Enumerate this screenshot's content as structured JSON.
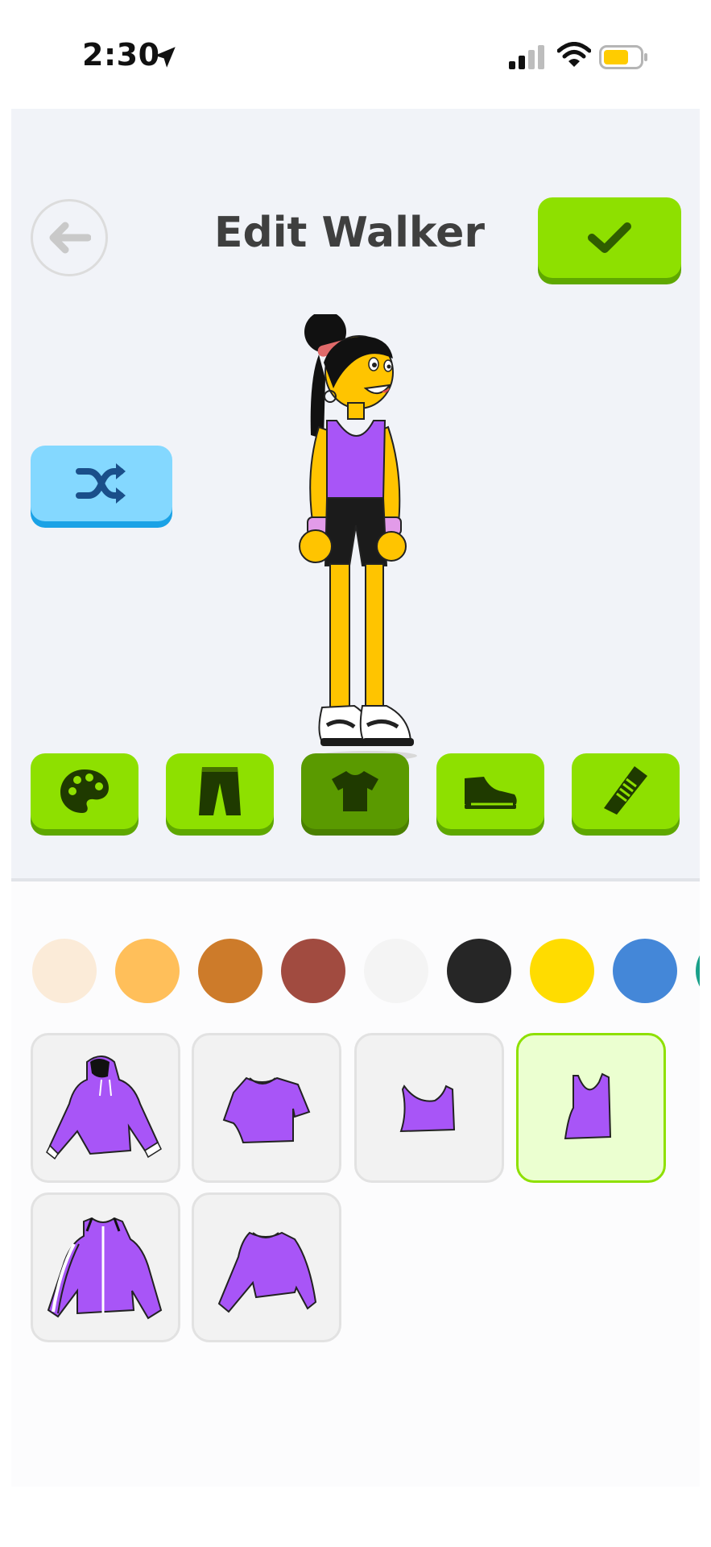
{
  "status_bar": {
    "time": "2:30",
    "icons": [
      "location-arrow-icon",
      "cellular-signal-icon",
      "wifi-icon",
      "battery-icon"
    ],
    "battery_color": "#ffcc00"
  },
  "header": {
    "title": "Edit Walker",
    "back_icon": "arrow-left-icon",
    "confirm_icon": "checkmark-icon"
  },
  "shuffle": {
    "icon": "shuffle-icon"
  },
  "categories": [
    {
      "id": "skin",
      "icon": "palette-icon",
      "selected": false
    },
    {
      "id": "bottoms",
      "icon": "pants-icon",
      "selected": false
    },
    {
      "id": "tops",
      "icon": "shirt-icon",
      "selected": true
    },
    {
      "id": "shoes",
      "icon": "shoe-icon",
      "selected": false
    },
    {
      "id": "hair",
      "icon": "comb-icon",
      "selected": false
    }
  ],
  "color_swatches": [
    "#fbebd8",
    "#ffbf5a",
    "#cd7b2a",
    "#a14b40",
    "#f4f4f4",
    "#262626",
    "#ffdc00",
    "#4487d8",
    "#1aa08a"
  ],
  "items": [
    {
      "name": "hoodie",
      "selected": false
    },
    {
      "name": "t-shirt",
      "selected": false
    },
    {
      "name": "crop-tank",
      "selected": false
    },
    {
      "name": "tank-top",
      "selected": true
    },
    {
      "name": "track-jacket",
      "selected": false
    },
    {
      "name": "long-sleeve-crop",
      "selected": false
    }
  ],
  "colors": {
    "accent_green": "#8ee000",
    "accent_green_dark": "#5a9a00",
    "shuffle_blue": "#84d8ff",
    "item_purple": "#a855f7"
  }
}
